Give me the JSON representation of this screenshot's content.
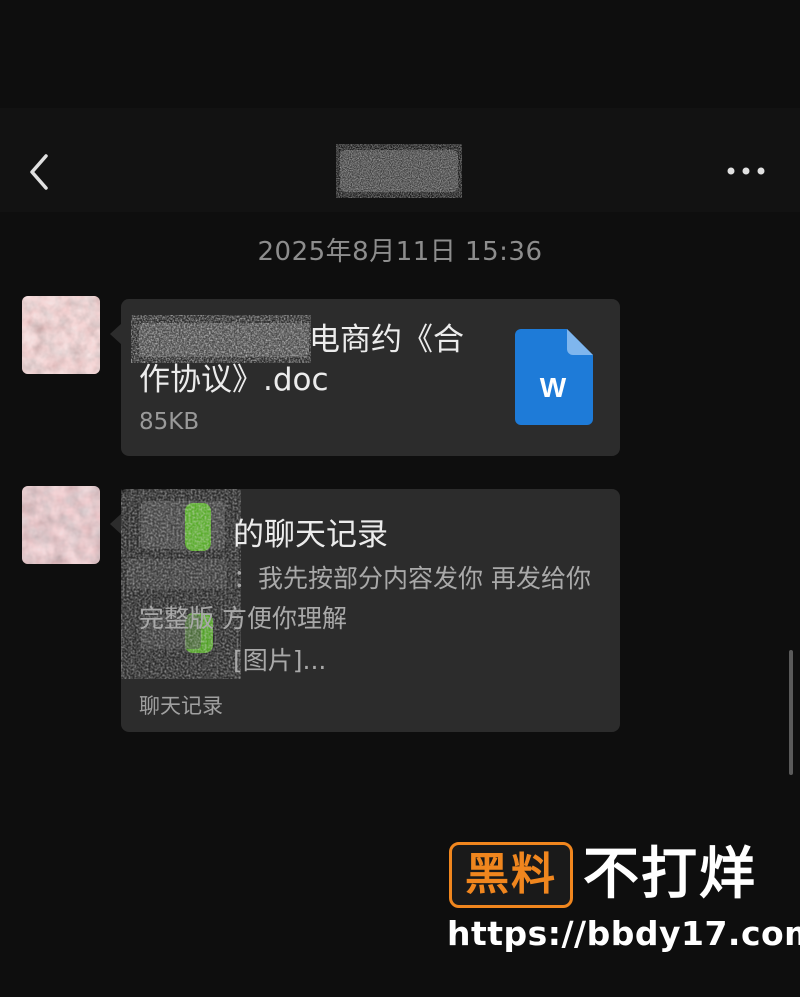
{
  "nav": {
    "back_icon": "chevron-left-icon",
    "more_icon": "more-horizontal-icon"
  },
  "timestamp": "2025年8月11日 15:36",
  "messages": [
    {
      "type": "file",
      "file_name_visible_line1": "电商约《合",
      "file_name_visible_line2": "作协议》.doc",
      "file_size": "85KB",
      "file_icon": "word-document-icon",
      "file_icon_letter": "W"
    },
    {
      "type": "chat-record",
      "title_visible": "的聊天记录",
      "line1": "：我先按部分内容发你 再发给你",
      "line2": "完整版 方便你理解",
      "line3": "[图片]...",
      "footer": "聊天记录"
    }
  ],
  "watermark": {
    "logo": "黑料",
    "slogan": "不打烊",
    "url": "https://bbdy17.com"
  },
  "colors": {
    "background": "#0e0e0e",
    "bubble": "#2c2c2c",
    "word_blue": "#1e7bd8",
    "watermark_orange": "#f0861e"
  }
}
